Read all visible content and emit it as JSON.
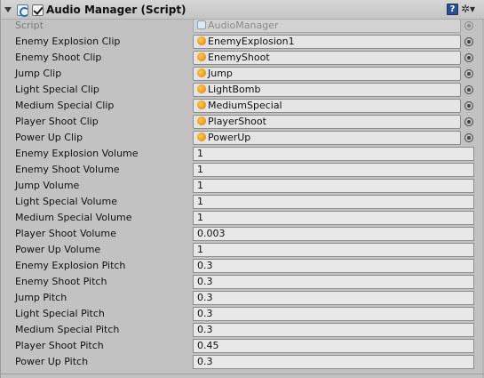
{
  "component": {
    "title": "Audio Manager (Script)",
    "enabled": true,
    "icons": {
      "foldout": "foldout-arrow-icon",
      "script": "script-icon",
      "help": "help-icon",
      "settings": "gear-icon"
    },
    "help_glyph": "?",
    "gear_glyph": "✲▾"
  },
  "script_row": {
    "label": "Script",
    "value": "AudioManager"
  },
  "clips": [
    {
      "label": "Enemy Explosion Clip",
      "value": "EnemyExplosion1"
    },
    {
      "label": "Enemy Shoot Clip",
      "value": "EnemyShoot"
    },
    {
      "label": "Jump Clip",
      "value": "Jump"
    },
    {
      "label": "Light Special Clip",
      "value": "LightBomb"
    },
    {
      "label": "Medium Special Clip",
      "value": "MediumSpecial"
    },
    {
      "label": "Player Shoot Clip",
      "value": "PlayerShoot"
    },
    {
      "label": "Power Up Clip",
      "value": "PowerUp"
    }
  ],
  "volumes": [
    {
      "label": "Enemy Explosion Volume",
      "value": "1"
    },
    {
      "label": "Enemy Shoot Volume",
      "value": "1"
    },
    {
      "label": "Jump Volume",
      "value": "1"
    },
    {
      "label": "Light Special Volume",
      "value": "1"
    },
    {
      "label": "Medium Special Volume",
      "value": "1"
    },
    {
      "label": "Player Shoot Volume",
      "value": "0.003"
    },
    {
      "label": "Power Up Volume",
      "value": "1"
    }
  ],
  "pitches": [
    {
      "label": "Enemy Explosion Pitch",
      "value": "0.3"
    },
    {
      "label": "Enemy Shoot Pitch",
      "value": "0.3"
    },
    {
      "label": "Jump Pitch",
      "value": "0.3"
    },
    {
      "label": "Light Special Pitch",
      "value": "0.3"
    },
    {
      "label": "Medium Special Pitch",
      "value": "0.3"
    },
    {
      "label": "Player Shoot Pitch",
      "value": "0.45"
    },
    {
      "label": "Power Up Pitch",
      "value": "0.3"
    }
  ]
}
